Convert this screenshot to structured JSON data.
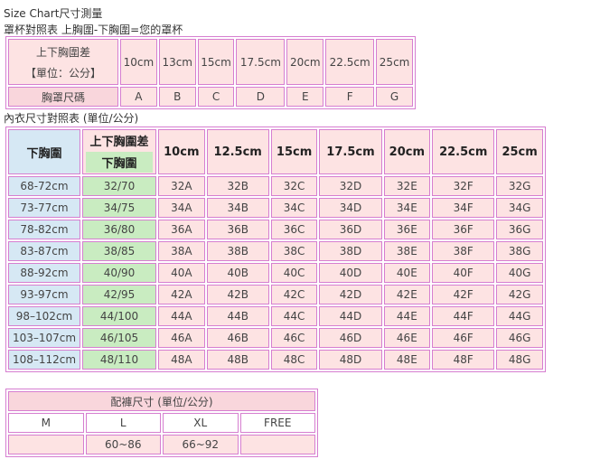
{
  "top_cut_text": "**********************",
  "title": "Size Chart尺寸測量",
  "cup_caption": "罩杯對照表 上胸圍-下胸圍=您的罩杯",
  "cup_table": {
    "header_label_line1": "上下胸圍差",
    "header_label_line2": "【單位：公分】",
    "diffs": [
      "10cm",
      "13cm",
      "15cm",
      "17.5cm",
      "20cm",
      "22.5cm",
      "25cm"
    ],
    "size_label": "胸罩尺碼",
    "cups": [
      "A",
      "B",
      "C",
      "D",
      "E",
      "F",
      "G"
    ]
  },
  "bra_caption": "內衣尺寸對照表 (單位/公分)",
  "bra_table": {
    "underbust_header": "下胸圍",
    "diff_header_line1": "上下胸圍差",
    "diff_header_line2": "下胸圍",
    "diffs": [
      "10cm",
      "12.5cm",
      "15cm",
      "17.5cm",
      "20cm",
      "22.5cm",
      "25cm"
    ],
    "rows": [
      {
        "range": "68-72cm",
        "band": "32/70",
        "sizes": [
          "32A",
          "32B",
          "32C",
          "32D",
          "32E",
          "32F",
          "32G"
        ]
      },
      {
        "range": "73-77cm",
        "band": "34/75",
        "sizes": [
          "34A",
          "34B",
          "34C",
          "34D",
          "34E",
          "34F",
          "34G"
        ]
      },
      {
        "range": "78-82cm",
        "band": "36/80",
        "sizes": [
          "36A",
          "36B",
          "36C",
          "36D",
          "36E",
          "36F",
          "36G"
        ]
      },
      {
        "range": "83-87cm",
        "band": "38/85",
        "sizes": [
          "38A",
          "38B",
          "38C",
          "38D",
          "38E",
          "38F",
          "38G"
        ]
      },
      {
        "range": "88-92cm",
        "band": "40/90",
        "sizes": [
          "40A",
          "40B",
          "40C",
          "40D",
          "40E",
          "40F",
          "40G"
        ]
      },
      {
        "range": "93-97cm",
        "band": "42/95",
        "sizes": [
          "42A",
          "42B",
          "42C",
          "42D",
          "42E",
          "42F",
          "42G"
        ]
      },
      {
        "range": "98–102cm",
        "band": "44/100",
        "sizes": [
          "44A",
          "44B",
          "44C",
          "44D",
          "44E",
          "44F",
          "44G"
        ]
      },
      {
        "range": "103–107cm",
        "band": "46/105",
        "sizes": [
          "46A",
          "46B",
          "46C",
          "46D",
          "46E",
          "46F",
          "46G"
        ]
      },
      {
        "range": "108–112cm",
        "band": "48/110",
        "sizes": [
          "48A",
          "48B",
          "48C",
          "48D",
          "48E",
          "48F",
          "48G"
        ]
      }
    ]
  },
  "panty_table": {
    "title": "配褲尺寸 (單位/公分)",
    "sizes": [
      "M",
      "L",
      "XL",
      "FREE"
    ],
    "values": [
      "",
      "60~86",
      "66~92",
      ""
    ]
  }
}
